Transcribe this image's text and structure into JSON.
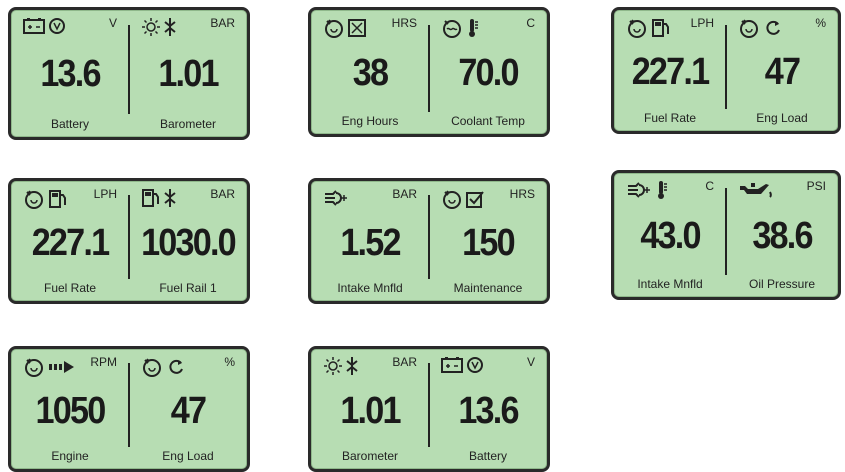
{
  "panels": [
    {
      "left": {
        "icons": [
          "battery-icon",
          "alternator-icon"
        ],
        "unit": "V",
        "value": "13.6",
        "label": "Battery"
      },
      "right": {
        "icons": [
          "sun-icon",
          "pressure-icon"
        ],
        "unit": "BAR",
        "value": "1.01",
        "label": "Barometer"
      }
    },
    {
      "left": {
        "icons": [
          "engine-icon",
          "hourglass-icon"
        ],
        "unit": "HRS",
        "value": "38",
        "label": "Eng Hours"
      },
      "right": {
        "icons": [
          "coolant-icon",
          "thermometer-icon"
        ],
        "unit": "C",
        "value": "70.0",
        "label": "Coolant Temp"
      }
    },
    {
      "left": {
        "icons": [
          "engine-icon",
          "fuel-pump-icon"
        ],
        "unit": "LPH",
        "value": "227.1",
        "label": "Fuel Rate"
      },
      "right": {
        "icons": [
          "engine-icon",
          "refresh-icon"
        ],
        "unit": "%",
        "value": "47",
        "label": "Eng Load"
      }
    },
    {
      "left": {
        "icons": [
          "engine-icon",
          "fuel-pump-icon"
        ],
        "unit": "LPH",
        "value": "227.1",
        "label": "Fuel Rate"
      },
      "right": {
        "icons": [
          "fuel-pump-icon",
          "pressure-icon"
        ],
        "unit": "BAR",
        "value": "1030.0",
        "label": "Fuel Rail 1"
      }
    },
    {
      "left": {
        "icons": [
          "intake-manifold-icon"
        ],
        "unit": "BAR",
        "value": "1.52",
        "label": "Intake Mnfld"
      },
      "right": {
        "icons": [
          "engine-icon",
          "checkbox-icon"
        ],
        "unit": "HRS",
        "value": "150",
        "label": "Maintenance"
      }
    },
    {
      "left": {
        "icons": [
          "intake-manifold-icon",
          "thermometer-icon"
        ],
        "unit": "C",
        "value": "43.0",
        "label": "Intake Mnfld"
      },
      "right": {
        "icons": [
          "oil-can-icon"
        ],
        "unit": "PSI",
        "value": "38.6",
        "label": "Oil Pressure"
      }
    },
    {
      "left": {
        "icons": [
          "engine-icon",
          "arrow-right-icon"
        ],
        "unit": "RPM",
        "value": "1050",
        "label": "Engine"
      },
      "right": {
        "icons": [
          "engine-icon",
          "refresh-icon"
        ],
        "unit": "%",
        "value": "47",
        "label": "Eng Load"
      }
    },
    {
      "left": {
        "icons": [
          "sun-icon",
          "pressure-icon"
        ],
        "unit": "BAR",
        "value": "1.01",
        "label": "Barometer"
      },
      "right": {
        "icons": [
          "battery-icon",
          "alternator-icon"
        ],
        "unit": "V",
        "value": "13.6",
        "label": "Battery"
      }
    }
  ]
}
